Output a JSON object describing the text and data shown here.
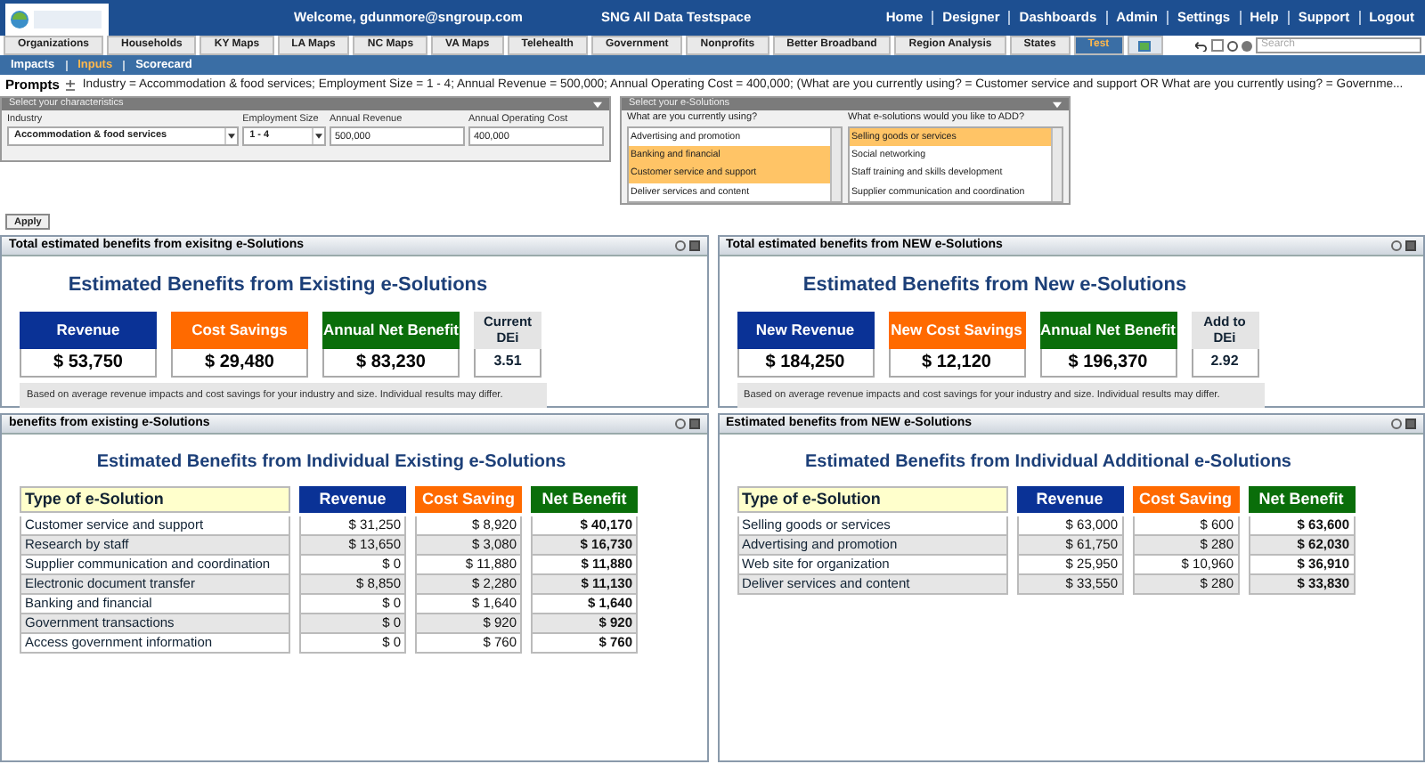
{
  "header": {
    "welcome": "Welcome, gdunmore@sngroup.com",
    "workspace": "SNG All Data Testspace",
    "nav": [
      "Home",
      "Designer",
      "Dashboards",
      "Admin",
      "Settings",
      "Help",
      "Support",
      "Logout"
    ]
  },
  "tabs": [
    {
      "label": "Organizations",
      "selected": false
    },
    {
      "label": "Households",
      "selected": false
    },
    {
      "label": "KY Maps",
      "selected": false
    },
    {
      "label": "LA Maps",
      "selected": false
    },
    {
      "label": "NC Maps",
      "selected": false
    },
    {
      "label": "VA Maps",
      "selected": false
    },
    {
      "label": "Telehealth",
      "selected": false
    },
    {
      "label": "Government",
      "selected": false
    },
    {
      "label": "Nonprofits",
      "selected": false
    },
    {
      "label": "Better Broadband",
      "selected": false
    },
    {
      "label": "Region Analysis",
      "selected": false
    },
    {
      "label": "States",
      "selected": false
    },
    {
      "label": "Test",
      "selected": true
    }
  ],
  "search": {
    "placeholder": "Search"
  },
  "subnav": [
    {
      "label": "Impacts",
      "selected": false
    },
    {
      "label": "Inputs",
      "selected": true
    },
    {
      "label": "Scorecard",
      "selected": false
    }
  ],
  "prompts": {
    "label": "Prompts",
    "text": "Industry = Accommodation & food services; Employment Size = 1 - 4; Annual Revenue = 500,000; Annual Operating Cost = 400,000; (What are you currently using? = Customer service and support OR What are you currently using? = Governme..."
  },
  "characteristics": {
    "title": "Select your characteristics",
    "fields": [
      {
        "kind": "select",
        "label": "Industry",
        "value": "Accommodation & food services"
      },
      {
        "kind": "select",
        "label": "Employment Size",
        "value": "1 - 4"
      },
      {
        "kind": "input",
        "label": "Annual Revenue",
        "value": "500,000"
      },
      {
        "kind": "input",
        "label": "Annual Operating Cost",
        "value": "400,000"
      }
    ]
  },
  "esolutions": {
    "title": "Select your e-Solutions",
    "lists": [
      {
        "label": "What are you currently using?",
        "items": [
          {
            "label": "Advertising and promotion",
            "selected": false
          },
          {
            "label": "Banking and financial",
            "selected": true
          },
          {
            "label": "Customer service and support",
            "selected": true
          },
          {
            "label": "Deliver services and content",
            "selected": false
          }
        ]
      },
      {
        "label": "What e-solutions would you like to ADD?",
        "items": [
          {
            "label": "Selling goods or services",
            "selected": true
          },
          {
            "label": "Social networking",
            "selected": false
          },
          {
            "label": "Staff training and skills development",
            "selected": false
          },
          {
            "label": "Supplier communication and coordination",
            "selected": false
          }
        ]
      }
    ]
  },
  "apply": "Apply",
  "summaries": [
    {
      "title": "Total estimated benefits from exisitng e-Solutions",
      "heading": "Estimated Benefits from Existing e-Solutions",
      "cards": [
        {
          "kind": "revenue",
          "label": "Revenue",
          "value": "$ 53,750"
        },
        {
          "kind": "cost",
          "label": "Cost Savings",
          "value": "$ 29,480"
        },
        {
          "kind": "net",
          "label": "Annual Net Benefit",
          "value": "$ 83,230"
        },
        {
          "kind": "dei",
          "label": "Current DEi",
          "value": "3.51"
        }
      ],
      "note": "Based on average revenue impacts and cost savings for your industry and size. Individual results may differ."
    },
    {
      "title": "Total estimated benefits from NEW e-Solutions",
      "heading": "Estimated Benefits from New e-Solutions",
      "cards": [
        {
          "kind": "revenue",
          "label": "New Revenue",
          "value": "$ 184,250"
        },
        {
          "kind": "cost",
          "label": "New Cost Savings",
          "value": "$ 12,120"
        },
        {
          "kind": "net",
          "label": "Annual Net Benefit",
          "value": "$ 196,370"
        },
        {
          "kind": "dei",
          "label": "Add to DEi",
          "value": "2.92"
        }
      ],
      "note": "Based on average revenue impacts and cost savings for your industry and size. Individual results may differ."
    }
  ],
  "details": [
    {
      "title": "benefits from existing e-Solutions",
      "heading": "Estimated Benefits from Individual Existing e-Solutions",
      "columns": [
        {
          "kind": "type",
          "label": "Type of e-Solution"
        },
        {
          "kind": "revenue",
          "label": "Revenue"
        },
        {
          "kind": "cost",
          "label": "Cost Saving"
        },
        {
          "kind": "net",
          "label": "Net Benefit"
        }
      ],
      "rows": [
        [
          "Customer service and support",
          "$ 31,250",
          "$ 8,920",
          "$ 40,170"
        ],
        [
          "Research by staff",
          "$ 13,650",
          "$ 3,080",
          "$ 16,730"
        ],
        [
          "Supplier communication and coordination",
          "$ 0",
          "$ 11,880",
          "$ 11,880"
        ],
        [
          "Electronic document transfer",
          "$ 8,850",
          "$ 2,280",
          "$ 11,130"
        ],
        [
          "Banking and financial",
          "$ 0",
          "$ 1,640",
          "$ 1,640"
        ],
        [
          "Government transactions",
          "$ 0",
          "$ 920",
          "$ 920"
        ],
        [
          "Access government information",
          "$ 0",
          "$ 760",
          "$ 760"
        ]
      ]
    },
    {
      "title": "Estimated benefits from NEW e-Solutions",
      "heading": "Estimated Benefits from Individual Additional e-Solutions",
      "columns": [
        {
          "kind": "type",
          "label": "Type of e-Solution"
        },
        {
          "kind": "revenue",
          "label": "Revenue"
        },
        {
          "kind": "cost",
          "label": "Cost Saving"
        },
        {
          "kind": "net",
          "label": "Net Benefit"
        }
      ],
      "rows": [
        [
          "Selling goods or services",
          "$ 63,000",
          "$ 600",
          "$ 63,600"
        ],
        [
          "Advertising and promotion",
          "$ 61,750",
          "$ 280",
          "$ 62,030"
        ],
        [
          "Web site for organization",
          "$ 25,950",
          "$ 10,960",
          "$ 36,910"
        ],
        [
          "Deliver services and content",
          "$ 33,550",
          "$ 280",
          "$ 33,830"
        ]
      ]
    }
  ]
}
